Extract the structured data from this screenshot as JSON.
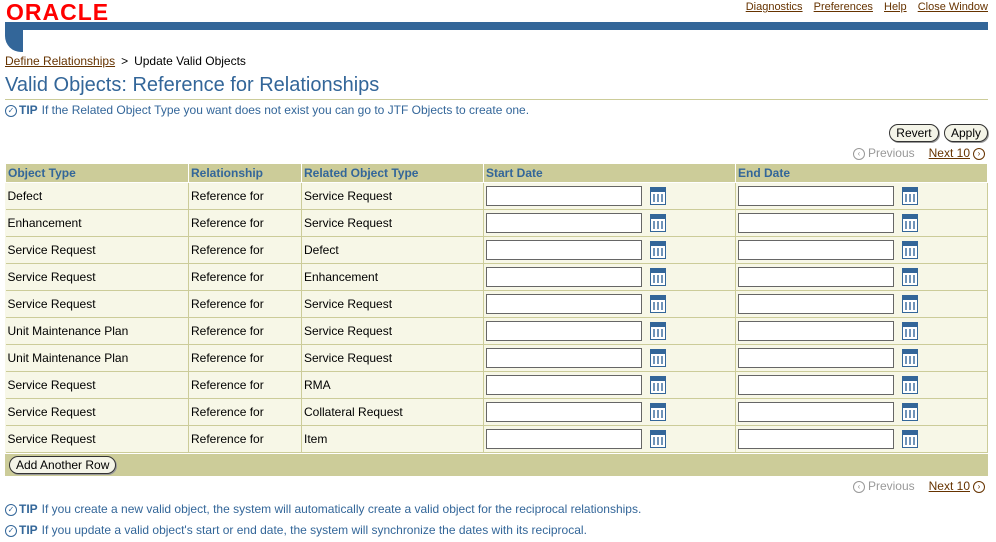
{
  "header": {
    "logo": "ORACLE",
    "links": [
      "Diagnostics",
      "Preferences",
      "Help",
      "Close Window"
    ]
  },
  "breadcrumb": {
    "parent": "Define Relationships",
    "separator": ">",
    "current": "Update Valid Objects"
  },
  "page_title": "Valid Objects: Reference for Relationships",
  "tips": {
    "label": "TIP",
    "top": "If the Related Object Type you want does not exist you can go to JTF Objects to create one.",
    "bottom1": "If you create a new valid object, the system will automatically create a valid object for the reciprocal relationships.",
    "bottom2": "If you update a valid object's start or end date, the system will synchronize the dates with its reciprocal."
  },
  "buttons": {
    "revert": "Revert",
    "apply": "Apply",
    "add_row": "Add Another Row"
  },
  "navigation": {
    "previous": "Previous",
    "next": "Next 10"
  },
  "table": {
    "columns": [
      "Object Type",
      "Relationship",
      "Related Object Type",
      "Start Date",
      "End Date"
    ],
    "rows": [
      {
        "object_type": "Defect",
        "relationship": "Reference for",
        "related": "Service Request",
        "start": "",
        "end": ""
      },
      {
        "object_type": "Enhancement",
        "relationship": "Reference for",
        "related": "Service Request",
        "start": "",
        "end": ""
      },
      {
        "object_type": "Service Request",
        "relationship": "Reference for",
        "related": "Defect",
        "start": "",
        "end": ""
      },
      {
        "object_type": "Service Request",
        "relationship": "Reference for",
        "related": "Enhancement",
        "start": "",
        "end": ""
      },
      {
        "object_type": "Service Request",
        "relationship": "Reference for",
        "related": "Service Request",
        "start": "",
        "end": ""
      },
      {
        "object_type": "Unit Maintenance Plan",
        "relationship": "Reference for",
        "related": "Service Request",
        "start": "",
        "end": ""
      },
      {
        "object_type": "Unit Maintenance Plan",
        "relationship": "Reference for",
        "related": "Service Request",
        "start": "",
        "end": ""
      },
      {
        "object_type": "Service Request",
        "relationship": "Reference for",
        "related": "RMA",
        "start": "",
        "end": ""
      },
      {
        "object_type": "Service Request",
        "relationship": "Reference for",
        "related": "Collateral Request",
        "start": "",
        "end": ""
      },
      {
        "object_type": "Service Request",
        "relationship": "Reference for",
        "related": "Item",
        "start": "",
        "end": ""
      }
    ]
  },
  "colors": {
    "brand_blue": "#336699",
    "header_tan": "#cccc99",
    "link_brown": "#663300",
    "logo_red": "#ff0000"
  }
}
